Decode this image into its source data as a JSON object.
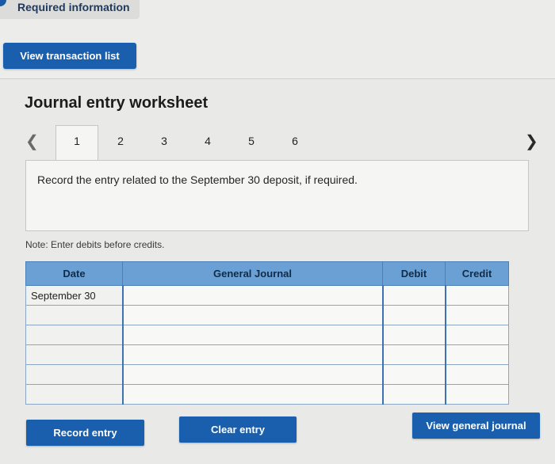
{
  "header": {
    "required_info_label": "Required information",
    "view_transaction_label": "View transaction list"
  },
  "worksheet": {
    "title": "Journal entry worksheet",
    "tabs": [
      "1",
      "2",
      "3",
      "4",
      "5",
      "6"
    ],
    "active_tab": "1",
    "prompt": "Record the entry related to the September 30 deposit, if required.",
    "note": "Note: Enter debits before credits."
  },
  "table": {
    "headers": [
      "Date",
      "General Journal",
      "Debit",
      "Credit"
    ],
    "rows": [
      {
        "date": "September 30",
        "account": "",
        "debit": "",
        "credit": ""
      },
      {
        "date": "",
        "account": "",
        "debit": "",
        "credit": ""
      },
      {
        "date": "",
        "account": "",
        "debit": "",
        "credit": ""
      },
      {
        "date": "",
        "account": "",
        "debit": "",
        "credit": ""
      },
      {
        "date": "",
        "account": "",
        "debit": "",
        "credit": ""
      },
      {
        "date": "",
        "account": "",
        "debit": "",
        "credit": ""
      }
    ]
  },
  "buttons": {
    "record": "Record entry",
    "clear": "Clear entry",
    "view_journal": "View general journal"
  },
  "colors": {
    "primary": "#1a5fad",
    "table_header": "#6aa0d4"
  }
}
